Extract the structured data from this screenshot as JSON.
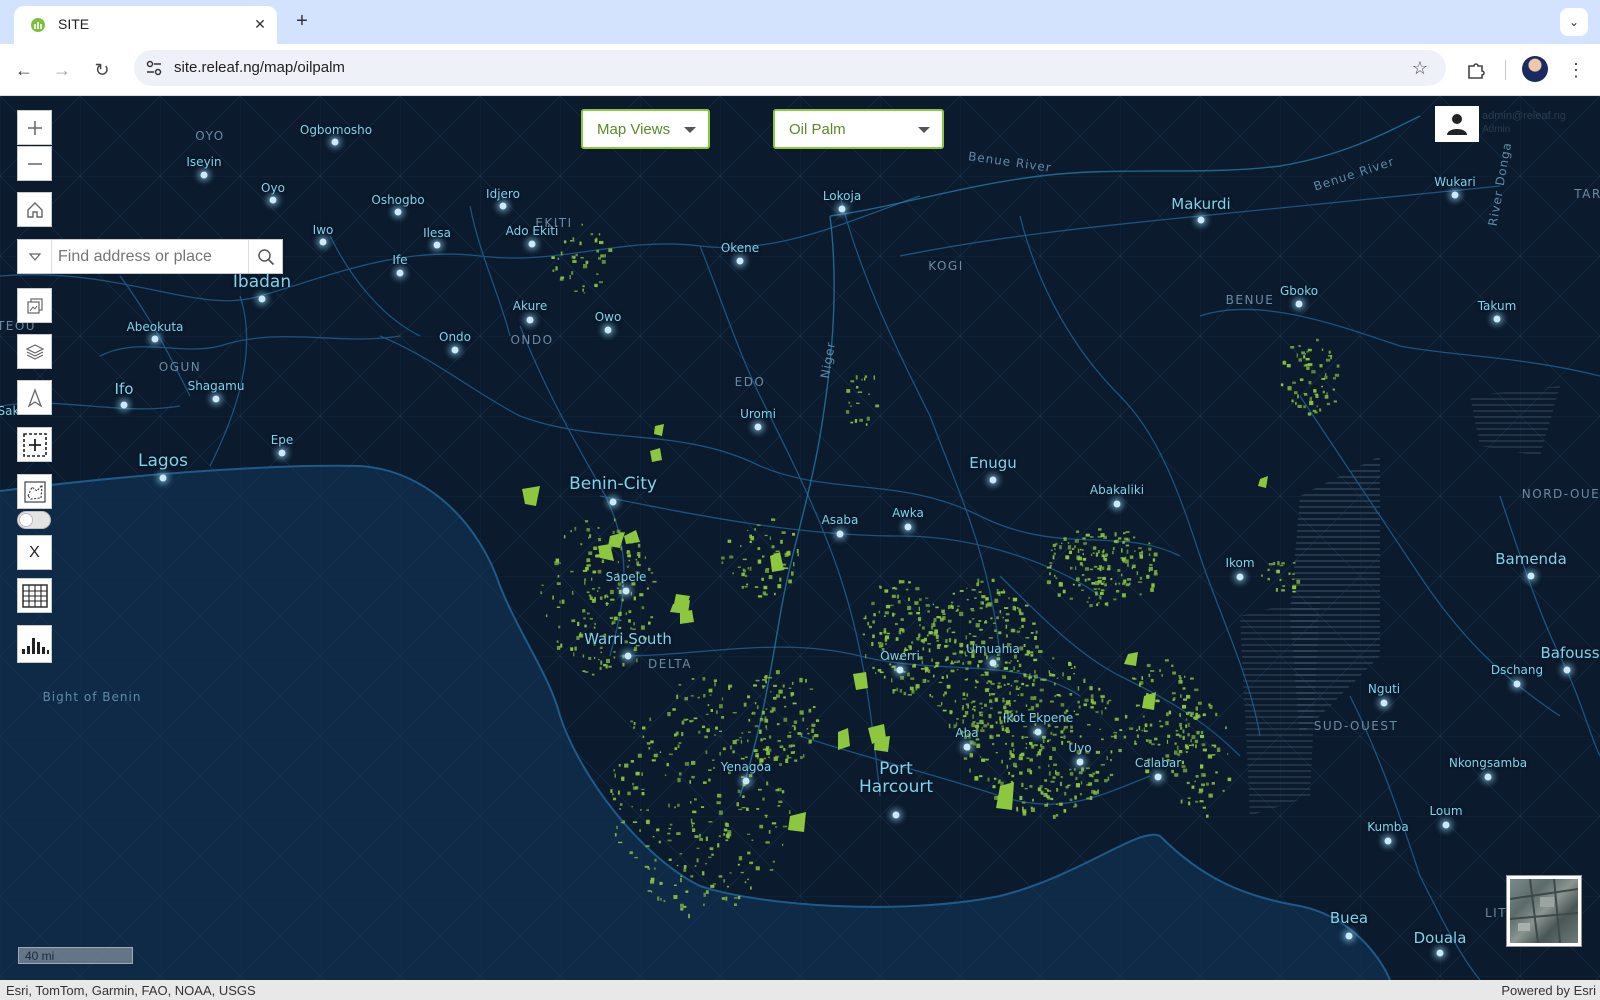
{
  "browser": {
    "tab_title": "SITE",
    "url_host": "site.releaf.ng",
    "url_path": "/map/oilpalm"
  },
  "map": {
    "search": {
      "placeholder": "Find address or place"
    },
    "dropdowns": {
      "map_views": "Map Views",
      "crop": "Oil Palm"
    },
    "user": {
      "email": "admin@releaf.ng",
      "sub": "Admin"
    },
    "scale_label": "40 mi",
    "toggle_on": false,
    "x_label": "X",
    "attribution": "Esri, TomTom, Garmin, FAO, NOAA, USGS",
    "powered_by": "Powered by Esri",
    "colors": {
      "land": "#0b1a2c",
      "sea": "#0e2a47",
      "roads": "#1e5a8a",
      "oil_palm": "#8dc63f"
    },
    "cities": [
      {
        "name": "Ogbomosho",
        "size": "s"
      },
      {
        "name": "Iseyin",
        "size": "s"
      },
      {
        "name": "Oyo",
        "size": "s"
      },
      {
        "name": "Oshogbo",
        "size": "s"
      },
      {
        "name": "Idjero",
        "size": "s"
      },
      {
        "name": "Iwo",
        "size": "s"
      },
      {
        "name": "Ilesa",
        "size": "s"
      },
      {
        "name": "Ado Ekiti",
        "size": "s"
      },
      {
        "name": "Ife",
        "size": "s"
      },
      {
        "name": "Ibadan",
        "size": "l"
      },
      {
        "name": "Abeokuta",
        "size": "s"
      },
      {
        "name": "Ondo",
        "size": "s"
      },
      {
        "name": "Akure",
        "size": "s"
      },
      {
        "name": "Owo",
        "size": "s"
      },
      {
        "name": "Ifo",
        "size": "m"
      },
      {
        "name": "Shagamu",
        "size": "s"
      },
      {
        "name": "Epe",
        "size": "s"
      },
      {
        "name": "Lagos",
        "size": "l"
      },
      {
        "name": "Lokoja",
        "size": "s"
      },
      {
        "name": "Okene",
        "size": "s"
      },
      {
        "name": "Makurdi",
        "size": "m"
      },
      {
        "name": "Wukari",
        "size": "s"
      },
      {
        "name": "Gboko",
        "size": "s"
      },
      {
        "name": "Takum",
        "size": "s"
      },
      {
        "name": "Uromi",
        "size": "s"
      },
      {
        "name": "Benin-City",
        "size": "l"
      },
      {
        "name": "Enugu",
        "size": "m"
      },
      {
        "name": "Abakaliki",
        "size": "s"
      },
      {
        "name": "Asaba",
        "size": "s"
      },
      {
        "name": "Awka",
        "size": "s"
      },
      {
        "name": "Sapele",
        "size": "s"
      },
      {
        "name": "Ikom",
        "size": "s"
      },
      {
        "name": "Bamenda",
        "size": "m"
      },
      {
        "name": "Warri South",
        "size": "m"
      },
      {
        "name": "Owerri",
        "size": "s"
      },
      {
        "name": "Umuahia",
        "size": "s"
      },
      {
        "name": "Bafouss",
        "size": "m"
      },
      {
        "name": "Dschang",
        "size": "s"
      },
      {
        "name": "Nguti",
        "size": "s"
      },
      {
        "name": "Ikot Ekpene",
        "size": "s"
      },
      {
        "name": "Aba",
        "size": "s"
      },
      {
        "name": "Uyo",
        "size": "s"
      },
      {
        "name": "Yenagoa",
        "size": "s"
      },
      {
        "name": "Calabar",
        "size": "s"
      },
      {
        "name": "Nkongsamba",
        "size": "s"
      },
      {
        "name": "Port Harcourt",
        "size": "l"
      },
      {
        "name": "Loum",
        "size": "s"
      },
      {
        "name": "Kumba",
        "size": "s"
      },
      {
        "name": "Buea",
        "size": "m"
      },
      {
        "name": "Douala",
        "size": "m"
      },
      {
        "name": "Sakete",
        "size": "s"
      }
    ],
    "regions": [
      "OYO",
      "EKITI",
      "KOGI",
      "BENUE",
      "ONDO",
      "OGUN",
      "EDO",
      "DELTA",
      "SUD-OUEST",
      "NORD-OUEST",
      "LIT",
      "TAR",
      "ITEOU"
    ],
    "water_labels": [
      "Bight of Benin",
      "Benue River",
      "Benue River",
      "Niger",
      "River Donga"
    ]
  }
}
